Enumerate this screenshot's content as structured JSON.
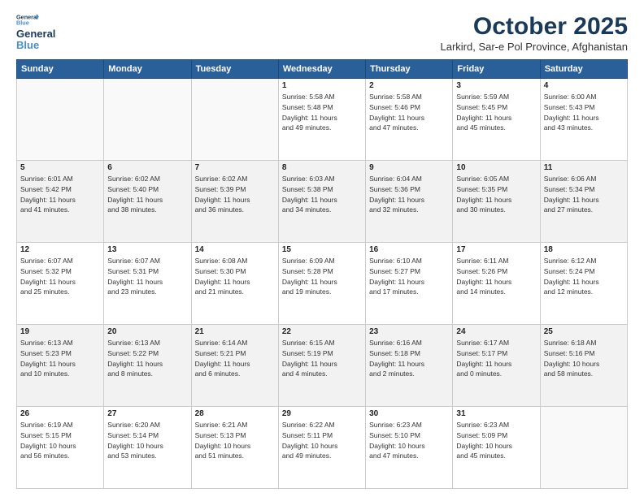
{
  "header": {
    "logo_general": "General",
    "logo_blue": "Blue",
    "month": "October 2025",
    "location": "Larkird, Sar-e Pol Province, Afghanistan"
  },
  "weekdays": [
    "Sunday",
    "Monday",
    "Tuesday",
    "Wednesday",
    "Thursday",
    "Friday",
    "Saturday"
  ],
  "weeks": [
    [
      {
        "day": "",
        "info": ""
      },
      {
        "day": "",
        "info": ""
      },
      {
        "day": "",
        "info": ""
      },
      {
        "day": "1",
        "info": "Sunrise: 5:58 AM\nSunset: 5:48 PM\nDaylight: 11 hours\nand 49 minutes."
      },
      {
        "day": "2",
        "info": "Sunrise: 5:58 AM\nSunset: 5:46 PM\nDaylight: 11 hours\nand 47 minutes."
      },
      {
        "day": "3",
        "info": "Sunrise: 5:59 AM\nSunset: 5:45 PM\nDaylight: 11 hours\nand 45 minutes."
      },
      {
        "day": "4",
        "info": "Sunrise: 6:00 AM\nSunset: 5:43 PM\nDaylight: 11 hours\nand 43 minutes."
      }
    ],
    [
      {
        "day": "5",
        "info": "Sunrise: 6:01 AM\nSunset: 5:42 PM\nDaylight: 11 hours\nand 41 minutes."
      },
      {
        "day": "6",
        "info": "Sunrise: 6:02 AM\nSunset: 5:40 PM\nDaylight: 11 hours\nand 38 minutes."
      },
      {
        "day": "7",
        "info": "Sunrise: 6:02 AM\nSunset: 5:39 PM\nDaylight: 11 hours\nand 36 minutes."
      },
      {
        "day": "8",
        "info": "Sunrise: 6:03 AM\nSunset: 5:38 PM\nDaylight: 11 hours\nand 34 minutes."
      },
      {
        "day": "9",
        "info": "Sunrise: 6:04 AM\nSunset: 5:36 PM\nDaylight: 11 hours\nand 32 minutes."
      },
      {
        "day": "10",
        "info": "Sunrise: 6:05 AM\nSunset: 5:35 PM\nDaylight: 11 hours\nand 30 minutes."
      },
      {
        "day": "11",
        "info": "Sunrise: 6:06 AM\nSunset: 5:34 PM\nDaylight: 11 hours\nand 27 minutes."
      }
    ],
    [
      {
        "day": "12",
        "info": "Sunrise: 6:07 AM\nSunset: 5:32 PM\nDaylight: 11 hours\nand 25 minutes."
      },
      {
        "day": "13",
        "info": "Sunrise: 6:07 AM\nSunset: 5:31 PM\nDaylight: 11 hours\nand 23 minutes."
      },
      {
        "day": "14",
        "info": "Sunrise: 6:08 AM\nSunset: 5:30 PM\nDaylight: 11 hours\nand 21 minutes."
      },
      {
        "day": "15",
        "info": "Sunrise: 6:09 AM\nSunset: 5:28 PM\nDaylight: 11 hours\nand 19 minutes."
      },
      {
        "day": "16",
        "info": "Sunrise: 6:10 AM\nSunset: 5:27 PM\nDaylight: 11 hours\nand 17 minutes."
      },
      {
        "day": "17",
        "info": "Sunrise: 6:11 AM\nSunset: 5:26 PM\nDaylight: 11 hours\nand 14 minutes."
      },
      {
        "day": "18",
        "info": "Sunrise: 6:12 AM\nSunset: 5:24 PM\nDaylight: 11 hours\nand 12 minutes."
      }
    ],
    [
      {
        "day": "19",
        "info": "Sunrise: 6:13 AM\nSunset: 5:23 PM\nDaylight: 11 hours\nand 10 minutes."
      },
      {
        "day": "20",
        "info": "Sunrise: 6:13 AM\nSunset: 5:22 PM\nDaylight: 11 hours\nand 8 minutes."
      },
      {
        "day": "21",
        "info": "Sunrise: 6:14 AM\nSunset: 5:21 PM\nDaylight: 11 hours\nand 6 minutes."
      },
      {
        "day": "22",
        "info": "Sunrise: 6:15 AM\nSunset: 5:19 PM\nDaylight: 11 hours\nand 4 minutes."
      },
      {
        "day": "23",
        "info": "Sunrise: 6:16 AM\nSunset: 5:18 PM\nDaylight: 11 hours\nand 2 minutes."
      },
      {
        "day": "24",
        "info": "Sunrise: 6:17 AM\nSunset: 5:17 PM\nDaylight: 11 hours\nand 0 minutes."
      },
      {
        "day": "25",
        "info": "Sunrise: 6:18 AM\nSunset: 5:16 PM\nDaylight: 10 hours\nand 58 minutes."
      }
    ],
    [
      {
        "day": "26",
        "info": "Sunrise: 6:19 AM\nSunset: 5:15 PM\nDaylight: 10 hours\nand 56 minutes."
      },
      {
        "day": "27",
        "info": "Sunrise: 6:20 AM\nSunset: 5:14 PM\nDaylight: 10 hours\nand 53 minutes."
      },
      {
        "day": "28",
        "info": "Sunrise: 6:21 AM\nSunset: 5:13 PM\nDaylight: 10 hours\nand 51 minutes."
      },
      {
        "day": "29",
        "info": "Sunrise: 6:22 AM\nSunset: 5:11 PM\nDaylight: 10 hours\nand 49 minutes."
      },
      {
        "day": "30",
        "info": "Sunrise: 6:23 AM\nSunset: 5:10 PM\nDaylight: 10 hours\nand 47 minutes."
      },
      {
        "day": "31",
        "info": "Sunrise: 6:23 AM\nSunset: 5:09 PM\nDaylight: 10 hours\nand 45 minutes."
      },
      {
        "day": "",
        "info": ""
      }
    ]
  ]
}
